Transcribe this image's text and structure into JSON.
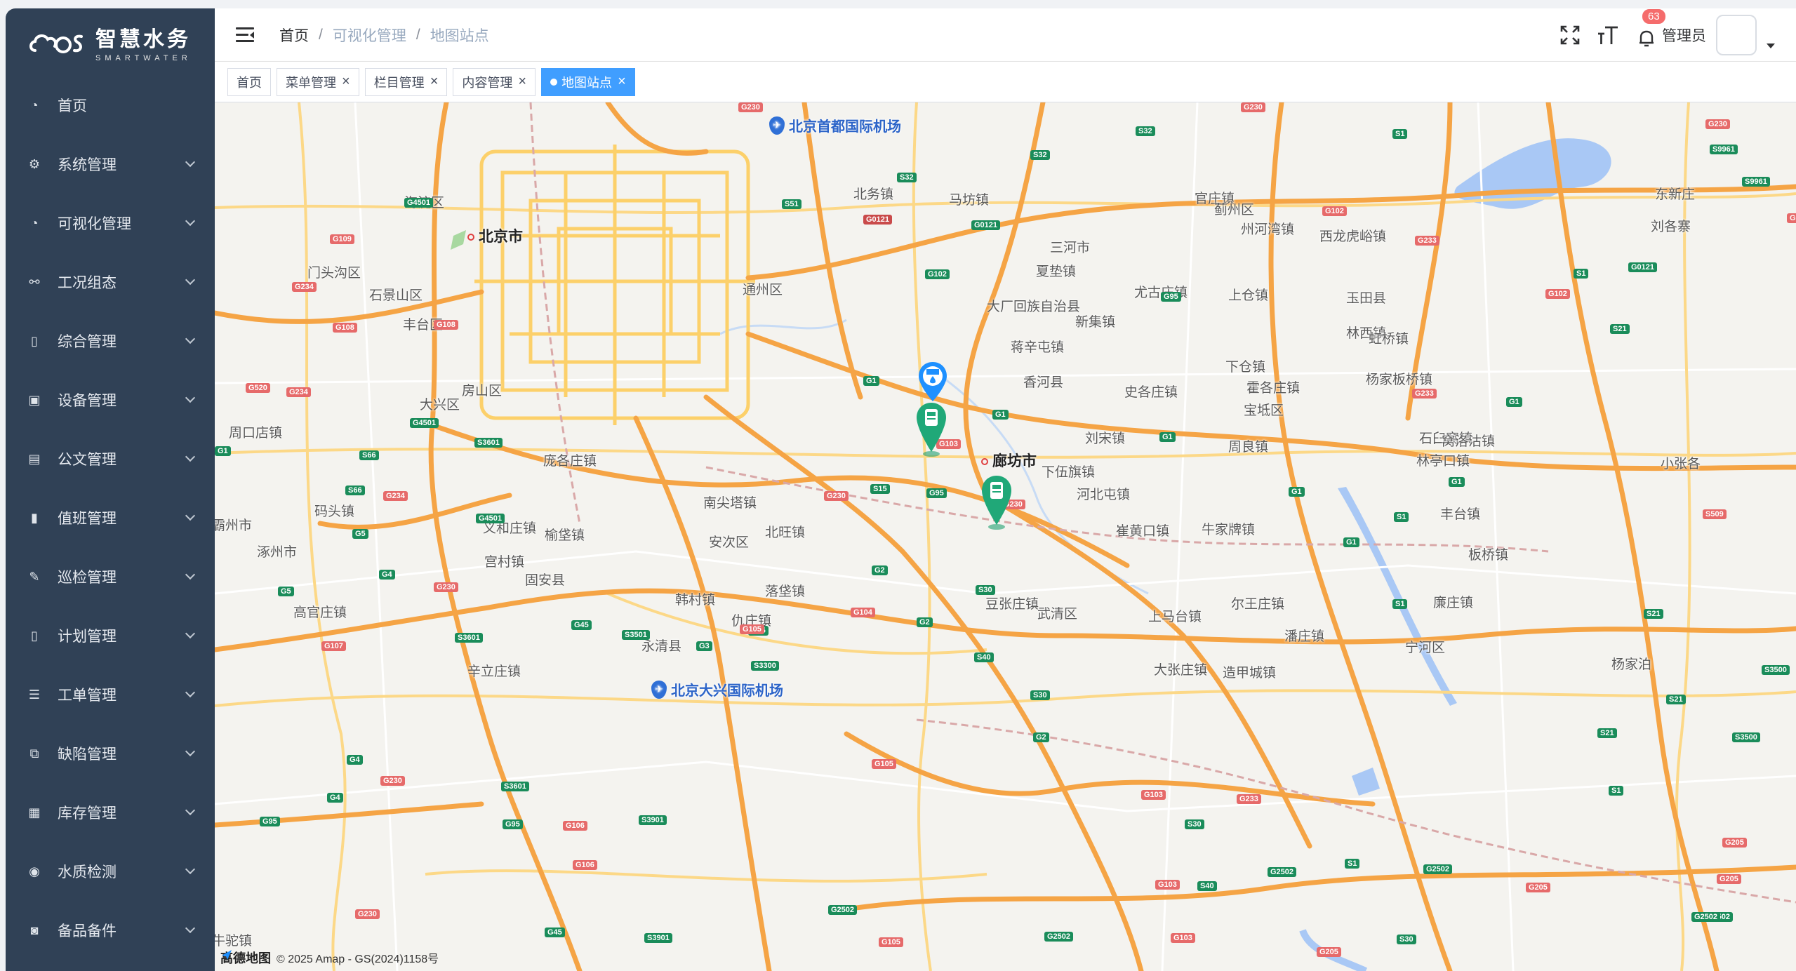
{
  "brand": {
    "name_cn": "智慧水务",
    "name_en": "SMARTWATER"
  },
  "sidebar": {
    "items": [
      {
        "label": "首页",
        "icon": "dashboard-icon",
        "has_arrow": false
      },
      {
        "label": "系统管理",
        "icon": "gear-icon",
        "has_arrow": true
      },
      {
        "label": "可视化管理",
        "icon": "dashboard-icon",
        "has_arrow": true
      },
      {
        "label": "工况组态",
        "icon": "tree-icon",
        "has_arrow": true
      },
      {
        "label": "综合管理",
        "icon": "book-icon",
        "has_arrow": true
      },
      {
        "label": "设备管理",
        "icon": "monitor-icon",
        "has_arrow": true
      },
      {
        "label": "公文管理",
        "icon": "document-icon",
        "has_arrow": true
      },
      {
        "label": "值班管理",
        "icon": "badge-icon",
        "has_arrow": true
      },
      {
        "label": "巡检管理",
        "icon": "edit-icon",
        "has_arrow": true
      },
      {
        "label": "计划管理",
        "icon": "book-icon",
        "has_arrow": true
      },
      {
        "label": "工单管理",
        "icon": "list-icon",
        "has_arrow": true
      },
      {
        "label": "缺陷管理",
        "icon": "puzzle-icon",
        "has_arrow": true
      },
      {
        "label": "库存管理",
        "icon": "table-icon",
        "has_arrow": true
      },
      {
        "label": "水质检测",
        "icon": "water-quality-icon",
        "has_arrow": true
      },
      {
        "label": "备品备件",
        "icon": "package-icon",
        "has_arrow": true
      }
    ]
  },
  "header": {
    "breadcrumb": [
      "首页",
      "可视化管理",
      "地图站点"
    ],
    "notification_count": "63",
    "username": "管理员"
  },
  "tags": [
    {
      "label": "首页",
      "closable": false,
      "active": false
    },
    {
      "label": "菜单管理",
      "closable": true,
      "active": false
    },
    {
      "label": "栏目管理",
      "closable": true,
      "active": false
    },
    {
      "label": "内容管理",
      "closable": true,
      "active": false
    },
    {
      "label": "地图站点",
      "closable": true,
      "active": true
    }
  ],
  "map": {
    "places": [
      {
        "name": "北京市",
        "big": true
      },
      {
        "name": "廊坊市",
        "big": true
      },
      {
        "name": "海淀区"
      },
      {
        "name": "门头沟区"
      },
      {
        "name": "石景山区"
      },
      {
        "name": "丰台区"
      },
      {
        "name": "通州区"
      },
      {
        "name": "大兴区"
      },
      {
        "name": "房山区"
      },
      {
        "name": "周口店镇"
      },
      {
        "name": "庞各庄镇"
      },
      {
        "name": "码头镇"
      },
      {
        "name": "义和庄镇"
      },
      {
        "name": "榆垡镇"
      },
      {
        "name": "涿州市"
      },
      {
        "name": "宫村镇"
      },
      {
        "name": "固安县"
      },
      {
        "name": "高官庄镇"
      },
      {
        "name": "永清县"
      },
      {
        "name": "辛立庄镇"
      },
      {
        "name": "韩村镇"
      },
      {
        "name": "仇庄镇"
      },
      {
        "name": "南尖塔镇"
      },
      {
        "name": "安次区"
      },
      {
        "name": "北旺镇"
      },
      {
        "name": "落垡镇"
      },
      {
        "name": "北务镇"
      },
      {
        "name": "马坊镇"
      },
      {
        "name": "三河市"
      },
      {
        "name": "夏垫镇"
      },
      {
        "name": "大厂回族自治县"
      },
      {
        "name": "蒋辛屯镇"
      },
      {
        "name": "香河县"
      },
      {
        "name": "新集镇"
      },
      {
        "name": "尤古庄镇"
      },
      {
        "name": "史各庄镇"
      },
      {
        "name": "刘宋镇"
      },
      {
        "name": "下伍旗镇"
      },
      {
        "name": "河北屯镇"
      },
      {
        "name": "崔黄口镇"
      },
      {
        "name": "牛家牌镇"
      },
      {
        "name": "豆张庄镇"
      },
      {
        "name": "武清区"
      },
      {
        "name": "上马台镇"
      },
      {
        "name": "大张庄镇"
      },
      {
        "name": "官庄镇"
      },
      {
        "name": "蓟州区"
      },
      {
        "name": "州河湾镇"
      },
      {
        "name": "西龙虎峪镇"
      },
      {
        "name": "上仓镇"
      },
      {
        "name": "玉田县"
      },
      {
        "name": "林西镇"
      },
      {
        "name": "虹桥镇"
      },
      {
        "name": "下仓镇"
      },
      {
        "name": "杨家板桥镇"
      },
      {
        "name": "霍各庄镇"
      },
      {
        "name": "宝坻区"
      },
      {
        "name": "石臼窝镇"
      },
      {
        "name": "窝洛沽镇"
      },
      {
        "name": "周良镇"
      },
      {
        "name": "林亭口镇"
      },
      {
        "name": "丰台镇"
      },
      {
        "name": "尔王庄镇"
      },
      {
        "name": "潘庄镇"
      },
      {
        "name": "造甲城镇"
      },
      {
        "name": "宁河区"
      },
      {
        "name": "廉庄镇"
      },
      {
        "name": "板桥镇"
      },
      {
        "name": "东新庄"
      },
      {
        "name": "刘各寨"
      },
      {
        "name": "小张各"
      },
      {
        "name": "杨家泊"
      },
      {
        "name": "霸州市"
      },
      {
        "name": "牛驼镇"
      }
    ],
    "airports": [
      "北京首都国际机场",
      "北京大兴国际机场"
    ],
    "attribution_logo": "高德地图",
    "attribution": "© 2025 Amap - GS(2024)1158号"
  }
}
